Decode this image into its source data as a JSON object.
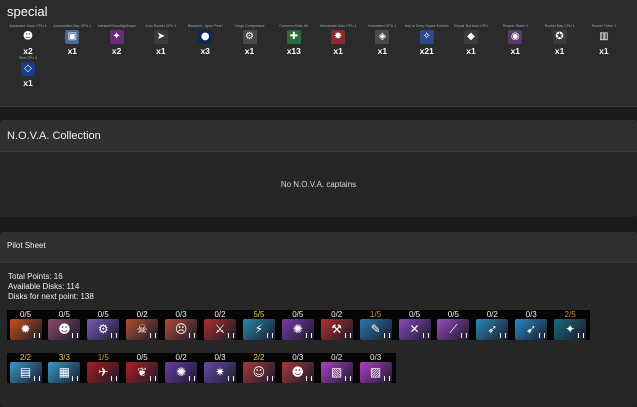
{
  "special": {
    "title": "special",
    "items": [
      {
        "name": "Advanced Jump CPU 1",
        "count": "x2",
        "icon": "fox-face-icon",
        "color": "#2a2a2a",
        "glyph": "☻"
      },
      {
        "name": "Ammunition Bay CPU 1",
        "count": "x1",
        "icon": "ammo-bay-icon",
        "color": "#4a6a9a",
        "glyph": "▣"
      },
      {
        "name": "Infested Broodlighthope",
        "count": "x2",
        "icon": "brood-icon",
        "color": "#6a2a7a",
        "glyph": "✦"
      },
      {
        "name": "Auto Rocket CPU 1",
        "count": "x1",
        "icon": "rocket-icon",
        "color": "#3a3a3a",
        "glyph": "➤"
      },
      {
        "name": "Blueprint - Apex Pearl",
        "count": "x3",
        "icon": "pearl-icon",
        "color": "#0a2a5a",
        "glyph": "●"
      },
      {
        "name": "Cargo Compressor",
        "count": "x1",
        "icon": "compressor-icon",
        "color": "#4a4a4a",
        "glyph": "⚙"
      },
      {
        "name": "Common Relic Kit",
        "count": "x13",
        "icon": "relic-kit-icon",
        "color": "#2a6a3a",
        "glyph": "✚"
      },
      {
        "name": "Heliobeam Auto CPU 1",
        "count": "x1",
        "icon": "heliobeam-icon",
        "color": "#8a2a2a",
        "glyph": "✸"
      },
      {
        "name": "Invisatlerd CPU 1",
        "count": "x1",
        "icon": "invis-icon",
        "color": "#4a4a4a",
        "glyph": "◈"
      },
      {
        "name": "Key to Deep Space Echoes",
        "count": "x21",
        "icon": "key-icon",
        "color": "#2a4a8a",
        "glyph": "✧"
      },
      {
        "name": "Repair Bot Auto CPU",
        "count": "x1",
        "icon": "repair-bot-icon",
        "color": "#3a3a3a",
        "glyph": "◆"
      },
      {
        "name": "Reaper Skate 4",
        "count": "x1",
        "icon": "reaper-icon",
        "color": "#5a3a6a",
        "glyph": "◉"
      },
      {
        "name": "Rocket Bay CPU 1",
        "count": "x1",
        "icon": "rocket-bay-icon",
        "color": "#3a3a3a",
        "glyph": "✪"
      },
      {
        "name": "Rocket Turbo 1",
        "count": "x1",
        "icon": "turbo-icon",
        "color": "#2a2a2a",
        "glyph": "▥"
      },
      {
        "name": "Sea CPU 4",
        "count": "x1",
        "icon": "sea-cpu-icon",
        "color": "#1a3a8a",
        "glyph": "◇"
      }
    ]
  },
  "nova": {
    "title": "N.O.V.A. Collection",
    "empty_text": "No N.O.V.A. captains"
  },
  "pilot": {
    "title": "Pilot Sheet",
    "total_points": "Total Points: 16",
    "available_disks": "Available Disks: 114",
    "disks_next": "Disks for next point: 138",
    "row1": [
      {
        "level": "0/5",
        "tone": "white",
        "icon": "explosion-disk-icon",
        "color": "#c8501a",
        "glyph": "✹"
      },
      {
        "level": "0/5",
        "tone": "white",
        "icon": "pilot-face-disk-icon",
        "color": "#8a4a6a",
        "glyph": "☻"
      },
      {
        "level": "0/5",
        "tone": "white",
        "icon": "gear-disk-icon",
        "color": "#7a5ab8",
        "glyph": "⚙"
      },
      {
        "level": "0/2",
        "tone": "white",
        "icon": "skull-pilot-disk-icon",
        "color": "#b05030",
        "glyph": "☠"
      },
      {
        "level": "0/3",
        "tone": "white",
        "icon": "brute-pilot-disk-icon",
        "color": "#b04a3a",
        "glyph": "☹"
      },
      {
        "level": "0/2",
        "tone": "white",
        "icon": "blade-disk-icon",
        "color": "#a8302a",
        "glyph": "⚔"
      },
      {
        "level": "5/5",
        "tone": "gold",
        "icon": "shield-beam-disk-icon",
        "color": "#2a8aa8",
        "glyph": "⚡"
      },
      {
        "level": "0/5",
        "tone": "white",
        "icon": "orb-disk-icon",
        "color": "#7a3aa8",
        "glyph": "✺"
      },
      {
        "level": "0/2",
        "tone": "white",
        "icon": "hammer-disk-icon",
        "color": "#b0302a",
        "glyph": "⚒"
      },
      {
        "level": "1/5",
        "tone": "orange",
        "icon": "wrench-disk-icon",
        "color": "#2a7ab0",
        "glyph": "✎"
      },
      {
        "level": "0/5",
        "tone": "white",
        "icon": "laser-disk-icon",
        "color": "#8a4ac0",
        "glyph": "✕"
      },
      {
        "level": "0/5",
        "tone": "white",
        "icon": "beam-disk-icon",
        "color": "#9a4ac0",
        "glyph": "⟋"
      },
      {
        "level": "0/2",
        "tone": "white",
        "icon": "cannon-disk-icon",
        "color": "#2a8ab8",
        "glyph": "➶"
      },
      {
        "level": "0/3",
        "tone": "white",
        "icon": "missile-disk-icon",
        "color": "#2a8ac8",
        "glyph": "➹"
      },
      {
        "level": "2/5",
        "tone": "orange",
        "icon": "turret-disk-icon",
        "color": "#1a6a7a",
        "glyph": "✦"
      }
    ],
    "row2": [
      {
        "level": "2/2",
        "tone": "gold",
        "icon": "book-disk-icon",
        "color": "#3a9ac8",
        "glyph": "▤"
      },
      {
        "level": "3/3",
        "tone": "gold",
        "icon": "tome-disk-icon",
        "color": "#3a9ac8",
        "glyph": "▦"
      },
      {
        "level": "1/5",
        "tone": "orange",
        "icon": "raptor-disk-icon",
        "color": "#a8201a",
        "glyph": "✈"
      },
      {
        "level": "0/5",
        "tone": "white",
        "icon": "wings-disk-icon",
        "color": "#b02020",
        "glyph": "❦"
      },
      {
        "level": "0/2",
        "tone": "white",
        "icon": "claw-disk-icon",
        "color": "#6a3aa8",
        "glyph": "✺"
      },
      {
        "level": "0/3",
        "tone": "white",
        "icon": "spike-disk-icon",
        "color": "#6a4aa8",
        "glyph": "✷"
      },
      {
        "level": "2/2",
        "tone": "gold",
        "icon": "captain-face-disk-icon",
        "color": "#a83a3a",
        "glyph": "☺"
      },
      {
        "level": "0/3",
        "tone": "white",
        "icon": "veteran-face-disk-icon",
        "color": "#a83a3a",
        "glyph": "☻"
      },
      {
        "level": "0/2",
        "tone": "white",
        "icon": "crate-disk-icon",
        "color": "#b040c8",
        "glyph": "▧"
      },
      {
        "level": "0/3",
        "tone": "white",
        "icon": "cargo-disk-icon",
        "color": "#b040c8",
        "glyph": "▨"
      }
    ]
  }
}
